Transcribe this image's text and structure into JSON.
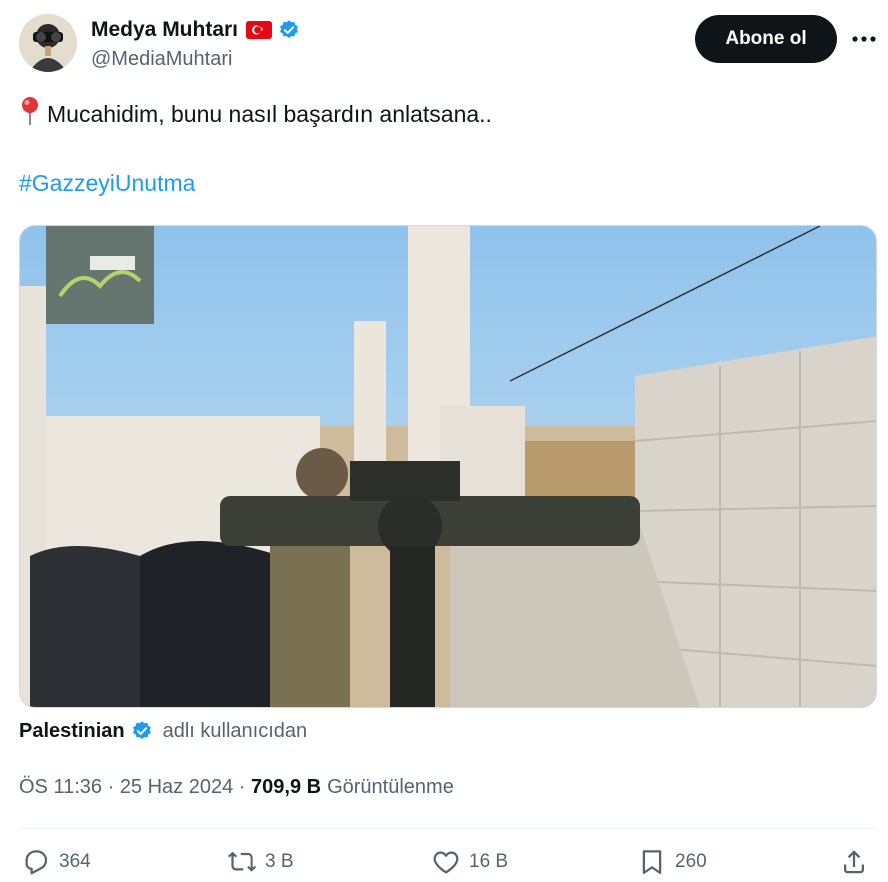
{
  "author": {
    "display_name": "Medya Muhtarı",
    "handle": "@MediaMuhtari",
    "flag_icon": "turkey-flag-icon",
    "verified_icon": "verified-badge-icon"
  },
  "follow_button": {
    "label": "Abone ol"
  },
  "tweet": {
    "text": "Mucahidim, bunu nasıl başardın anlatsana..",
    "hashtag": "#GazzeyiUnutma"
  },
  "attribution": {
    "name": "Palestinian",
    "suffix": "adlı kullanıcıdan"
  },
  "meta": {
    "time": "ÖS 11:36",
    "date": "25 Haz 2024",
    "views_count": "709,9 B",
    "views_label": "Görüntülenme"
  },
  "actions": {
    "replies": "364",
    "reposts": "3 B",
    "likes": "16 B",
    "bookmarks": "260"
  },
  "colors": {
    "accent": "#1d9bf0",
    "text": "#0f1419",
    "muted": "#536471",
    "button_bg": "#0f1419"
  }
}
